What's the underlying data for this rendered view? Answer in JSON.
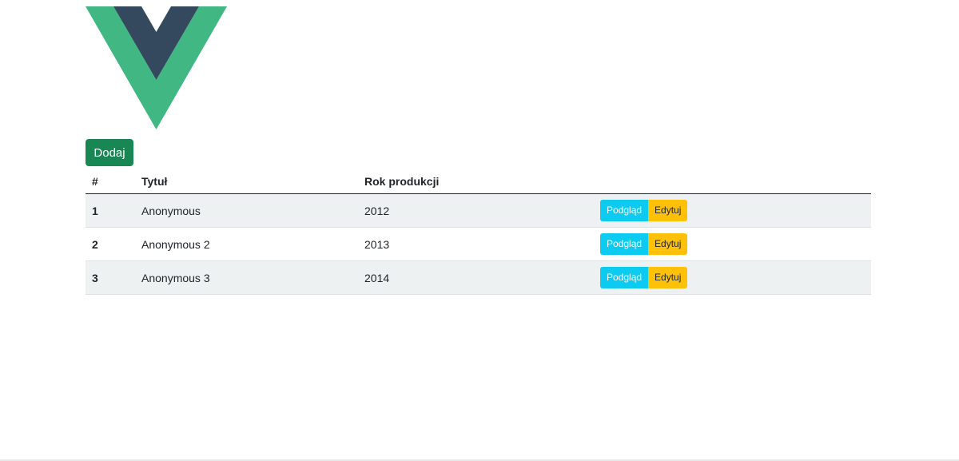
{
  "logo": {
    "name": "vue-logo",
    "outer_color": "#41b883",
    "inner_color": "#34495e"
  },
  "toolbar": {
    "add_label": "Dodaj",
    "add_color": "#198754"
  },
  "table": {
    "headers": [
      "#",
      "Tytuł",
      "Rok produkcji",
      ""
    ],
    "rows": [
      {
        "num": "1",
        "title": "Anonymous",
        "year": "2012",
        "view_label": "Podgląd",
        "edit_label": "Edytuj"
      },
      {
        "num": "2",
        "title": "Anonymous 2",
        "year": "2013",
        "view_label": "Podgląd",
        "edit_label": "Edytuj"
      },
      {
        "num": "3",
        "title": "Anonymous 3",
        "year": "2014",
        "view_label": "Podgląd",
        "edit_label": "Edytuj"
      }
    ]
  },
  "colors": {
    "view_button": "#0dcaf0",
    "edit_button": "#ffc107",
    "striped_row": "#eef1f2"
  }
}
